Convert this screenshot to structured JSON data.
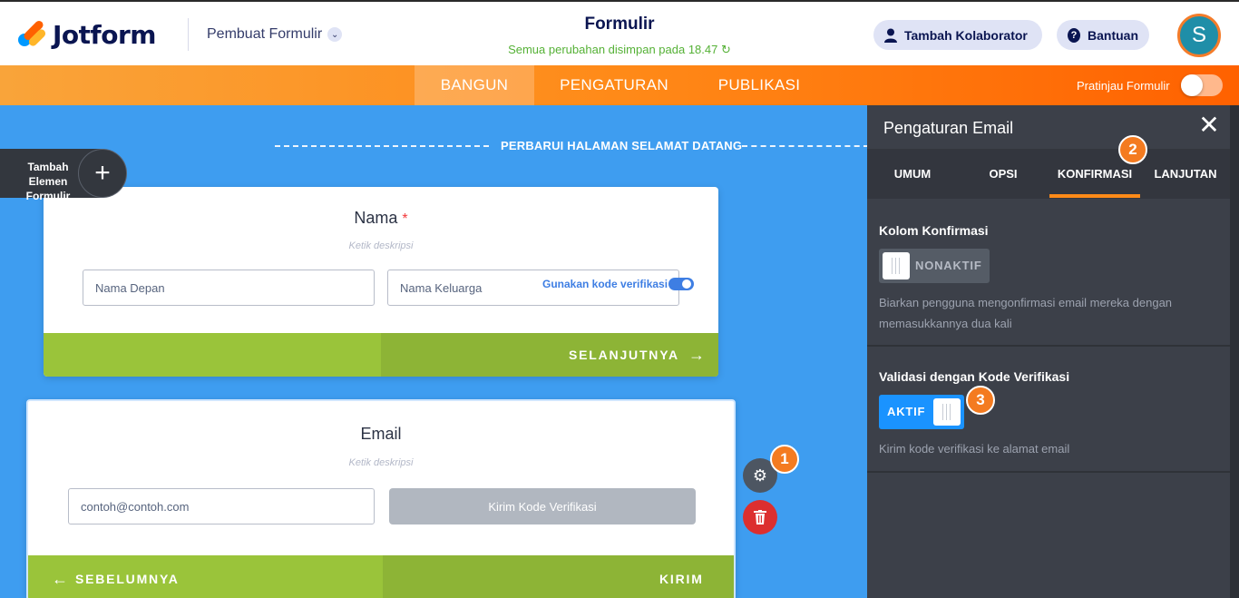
{
  "header": {
    "logo_text": "Jotform",
    "builder_dropdown": "Pembuat Formulir",
    "form_title": "Formulir",
    "save_status": "Semua perubahan disimpan pada 18.47",
    "collab_button": "Tambah Kolaborator",
    "help_button": "Bantuan",
    "avatar_letter": "S"
  },
  "nav": {
    "tabs": [
      {
        "label": "BANGUN",
        "active": true
      },
      {
        "label": "PENGATURAN",
        "active": false
      },
      {
        "label": "PUBLIKASI",
        "active": false
      }
    ],
    "preview_label": "Pratinjau Formulir"
  },
  "canvas": {
    "welcome_link": "PERBARUI HALAMAN SELAMAT DATANG",
    "add_element": "Tambah Elemen Formulir",
    "name_card": {
      "title": "Nama",
      "required_mark": "*",
      "description": "Ketik deskripsi",
      "first_placeholder": "Nama Depan",
      "last_placeholder": "Nama Keluarga",
      "next_button": "SELANJUTNYA"
    },
    "email_card": {
      "title": "Email",
      "description": "Ketik deskripsi",
      "verification_toggle": "Gunakan kode verifikasi",
      "email_placeholder": "contoh@contoh.com",
      "send_code_button": "Kirim Kode Verifikasi",
      "prev_button": "SEBELUMNYA",
      "submit_button": "KIRIM"
    }
  },
  "badges": [
    "1",
    "2",
    "3"
  ],
  "panel": {
    "title": "Pengaturan Email",
    "tabs": [
      {
        "label": "UMUM",
        "active": false
      },
      {
        "label": "OPSI",
        "active": false
      },
      {
        "label": "KONFIRMASI",
        "active": true
      },
      {
        "label": "LANJUTAN",
        "active": false
      }
    ],
    "confirm_section": {
      "title": "Kolom Konfirmasi",
      "toggle_label": "NONAKTIF",
      "help": "Biarkan pengguna mengonfirmasi email mereka dengan memasukkannya dua kali"
    },
    "validation_section": {
      "title": "Validasi dengan Kode Verifikasi",
      "toggle_label": "AKTIF",
      "help": "Kirim kode verifikasi ke alamat email"
    }
  },
  "colors": {
    "accent_orange": "#ff8a18",
    "canvas_blue": "#3e9df0",
    "green_bar": "#9ac43a",
    "panel_bg": "#3c4049",
    "toggle_on": "#1a93ff",
    "danger": "#dc2f2f"
  }
}
